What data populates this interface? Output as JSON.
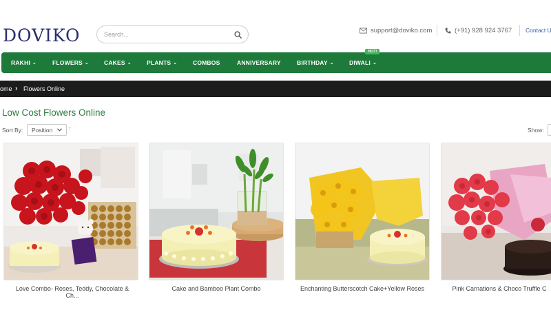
{
  "header": {
    "logo": "DOVIKO",
    "search_placeholder": "Search...",
    "email": "support@doviko.com",
    "phone": "(+91) 928 924 3767",
    "contact_link": "Contact Us"
  },
  "nav": {
    "items": [
      {
        "label": "RAKHI",
        "dropdown": true
      },
      {
        "label": "FLOWERS",
        "dropdown": true
      },
      {
        "label": "CAKES",
        "dropdown": true
      },
      {
        "label": "PLANTS",
        "dropdown": true
      },
      {
        "label": "COMBOS",
        "dropdown": false
      },
      {
        "label": "ANNIVERSARY",
        "dropdown": false
      },
      {
        "label": "BIRTHDAY",
        "dropdown": true
      },
      {
        "label": "DIWALI",
        "dropdown": true
      }
    ],
    "hot_badge": "HOT!"
  },
  "breadcrumb": {
    "home": "ome",
    "current": "Flowers Online"
  },
  "page": {
    "title": "Low Cost Flowers Online",
    "sort_label": "Sort By:",
    "sort_value": "Position",
    "show_label": "Show:"
  },
  "products": [
    {
      "name": "Love Combo- Roses, Teddy, Chocolate &",
      "name_line2": "Ch..."
    },
    {
      "name": "Cake and Bamboo Plant Combo"
    },
    {
      "name": "Enchanting Butterscotch Cake+Yellow Roses"
    },
    {
      "name": "Pink Carnations & Choco Truffle C"
    }
  ],
  "colors": {
    "nav_green": "#1e7a3a",
    "title_green": "#2e7d3e",
    "breadcrumb_bg": "#1c1c1c",
    "logo_navy": "#2a2e6e"
  },
  "icons": {
    "search": "search-icon",
    "email": "envelope-icon",
    "phone": "phone-icon",
    "breadcrumb_separator": "chevron-right-icon",
    "sort_direction": "arrow-up-icon",
    "dropdown": "chevron-down-icon"
  }
}
